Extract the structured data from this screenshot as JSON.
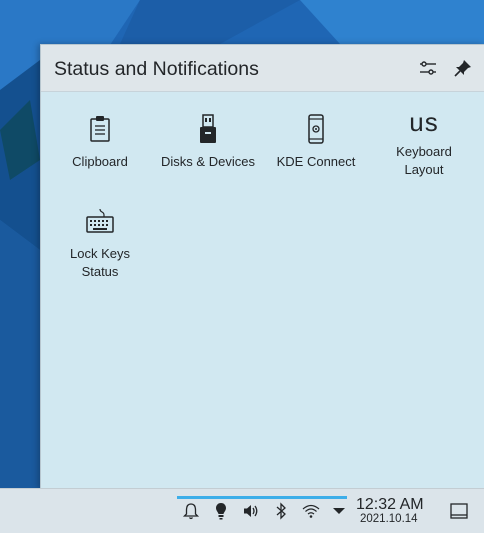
{
  "popup": {
    "title": "Status and Notifications",
    "configure_icon": "configure-icon",
    "pin_icon": "pin-icon",
    "applets": [
      {
        "label": "Clipboard",
        "icon": "clipboard-icon"
      },
      {
        "label": "Disks & Devices",
        "icon": "usb-drive-icon"
      },
      {
        "label": "KDE Connect",
        "icon": "phone-icon"
      },
      {
        "label_line1": "Keyboard",
        "label_line2": "Layout",
        "icon_text": "us"
      },
      {
        "label_line1": "Lock Keys",
        "label_line2": "Status",
        "icon": "keyboard-icon"
      }
    ]
  },
  "panel": {
    "tray_icons": [
      "bell-icon",
      "lightbulb-icon",
      "volume-icon",
      "bluetooth-icon",
      "wifi-icon",
      "expand-arrow-icon"
    ],
    "clock": {
      "time": "12:32 AM",
      "date": "2021.10.14"
    },
    "show_desktop_icon": "show-desktop-icon"
  },
  "colors": {
    "accent": "#3daee9",
    "popup_bg": "#d1e8f1",
    "header_bg": "#dfe6ea",
    "panel_bg": "#dbe4ea",
    "text": "#232629"
  }
}
